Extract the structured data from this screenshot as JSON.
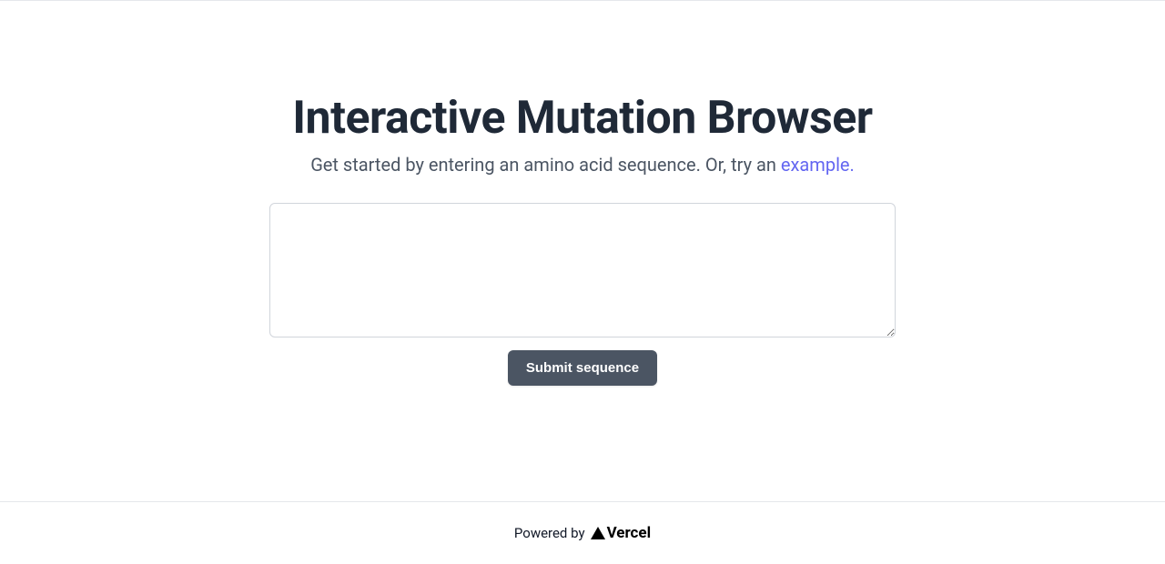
{
  "header": {
    "title": "Interactive Mutation Browser",
    "subtitle_prefix": "Get started by entering an amino acid sequence. Or, try an ",
    "example_link_text": "example."
  },
  "form": {
    "sequence_value": "",
    "submit_label": "Submit sequence"
  },
  "footer": {
    "powered_by": "Powered by",
    "vercel_name": "Vercel"
  }
}
